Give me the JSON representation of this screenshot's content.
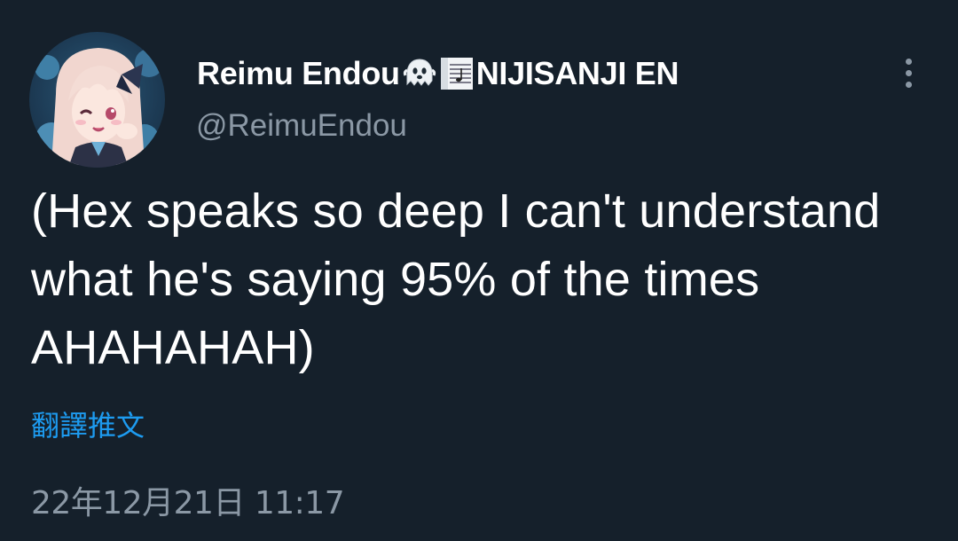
{
  "tweet": {
    "author": {
      "display_name": "Reimu Endou",
      "display_name_suffix": "NIJISANJI EN",
      "handle": "@ReimuEndou",
      "badges": [
        "ghost-emoji",
        "sheet-music-emoji"
      ]
    },
    "text": "(Hex speaks so deep I can't understand what he's saying 95% of the times AHAHAHAH)",
    "translate_label": "翻譯推文",
    "timestamp": "22年12月21日 11:17"
  },
  "colors": {
    "background": "#15202b",
    "text_primary": "#ffffff",
    "text_secondary": "#8b98a5",
    "link": "#1d9bf0"
  },
  "icons": {
    "more": "more-vertical-icon"
  }
}
